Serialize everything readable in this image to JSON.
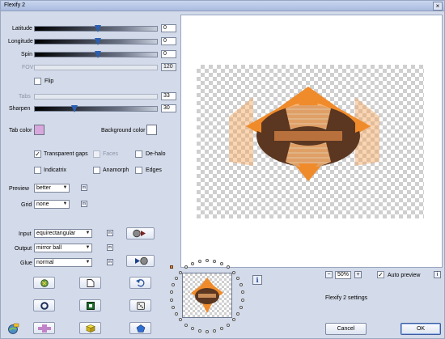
{
  "window": {
    "title": "Flexify 2",
    "close_label": "×"
  },
  "params": {
    "latitude": {
      "label": "Latitude",
      "value": "0",
      "fraction": 0.51
    },
    "longitude": {
      "label": "Longitude",
      "value": "0",
      "fraction": 0.51
    },
    "spin": {
      "label": "Spin",
      "value": "0",
      "fraction": 0.51
    },
    "fov": {
      "label": "FOV",
      "value": "120"
    },
    "flip": {
      "label": "Flip"
    },
    "tabs": {
      "label": "Tabs",
      "value": "33"
    },
    "sharpen": {
      "label": "Sharpen",
      "value": "30",
      "fraction": 0.32
    }
  },
  "colors": {
    "tab_color_label": "Tab color",
    "tab_color": "#d8a7dc",
    "background_color_label": "Background color",
    "background_color": "#ffffff"
  },
  "options": {
    "transparent_gaps": {
      "label": "Transparent gaps",
      "checked": true
    },
    "faces": {
      "label": "Faces"
    },
    "de_halo": {
      "label": "De-halo"
    },
    "indicatrix": {
      "label": "Indicatrix"
    },
    "anamorph": {
      "label": "Anamorph"
    },
    "edges": {
      "label": "Edges"
    }
  },
  "preview_settings": {
    "preview_label": "Preview",
    "preview_value": "better",
    "grid_label": "Grid",
    "grid_value": "none"
  },
  "projection": {
    "input_label": "Input",
    "input_value": "equirectangular",
    "output_label": "Output",
    "output_value": "mirror ball",
    "glue_label": "Glue",
    "glue_value": "normal"
  },
  "bottom": {
    "zoom_value": "50%",
    "zoom_minus": "−",
    "zoom_plus": "+",
    "auto_preview_label": "Auto preview",
    "auto_preview_checked": true,
    "settings_name": "Flexify 2 settings",
    "cancel_label": "Cancel",
    "ok_label": "OK",
    "info_label": "i",
    "check_mark": "✓"
  },
  "icon_names": [
    "globe-icon",
    "page-icon",
    "undo-icon",
    "ring-icon",
    "square-icon",
    "dice-icon",
    "plus-shape-icon",
    "cube-icon",
    "gem-icon",
    "preset-icon",
    "play-icon"
  ],
  "shape_colors": {
    "dark": "#5b3620",
    "mid": "#a0582a",
    "orange": "#f08b2b",
    "light": "#f5b77c"
  }
}
